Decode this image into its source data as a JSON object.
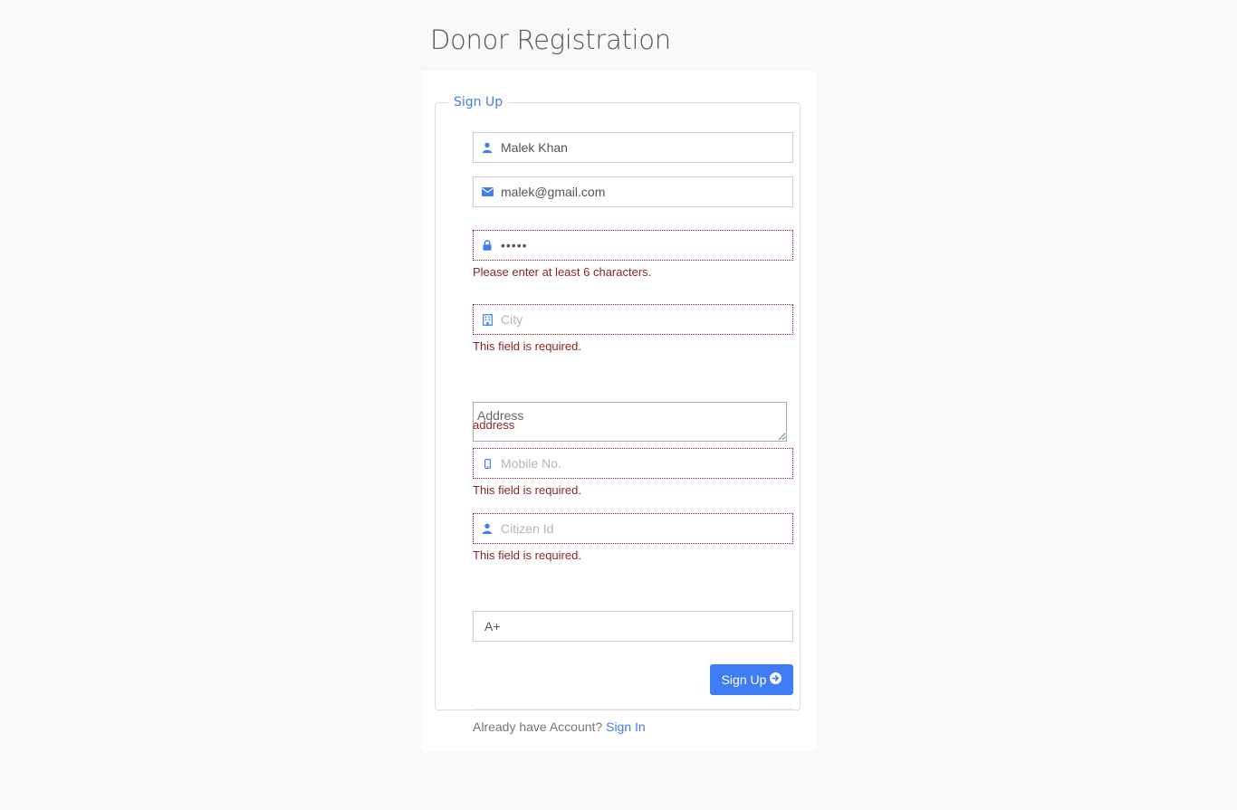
{
  "page": {
    "title": "Donor Registration"
  },
  "form": {
    "legend": "Sign Up",
    "name": {
      "value": "Malek Khan",
      "icon": "user-icon"
    },
    "email": {
      "value": "malek@gmail.com",
      "icon": "envelope-icon"
    },
    "password": {
      "value": "•••••",
      "icon": "lock-icon",
      "error": "Please enter at least 6 characters."
    },
    "city": {
      "value": "",
      "placeholder": "City",
      "icon": "building-icon",
      "error": "This field is required."
    },
    "address": {
      "value": "",
      "placeholder": "Address",
      "error": "address"
    },
    "mobile": {
      "value": "",
      "placeholder": "Mobile No.",
      "icon": "mobile-icon",
      "error": "This field is required."
    },
    "citizen_id": {
      "value": "",
      "placeholder": "Citizen Id",
      "icon": "user-icon",
      "error": "This field is required."
    },
    "blood_group": {
      "selected": "A+"
    },
    "submit_label": "Sign Up",
    "footer": {
      "prompt": "Already have Account?",
      "link_label": "Sign In"
    }
  },
  "colors": {
    "accent": "#3f7df5",
    "error": "#8b2525",
    "background": "#f9f9f9"
  }
}
